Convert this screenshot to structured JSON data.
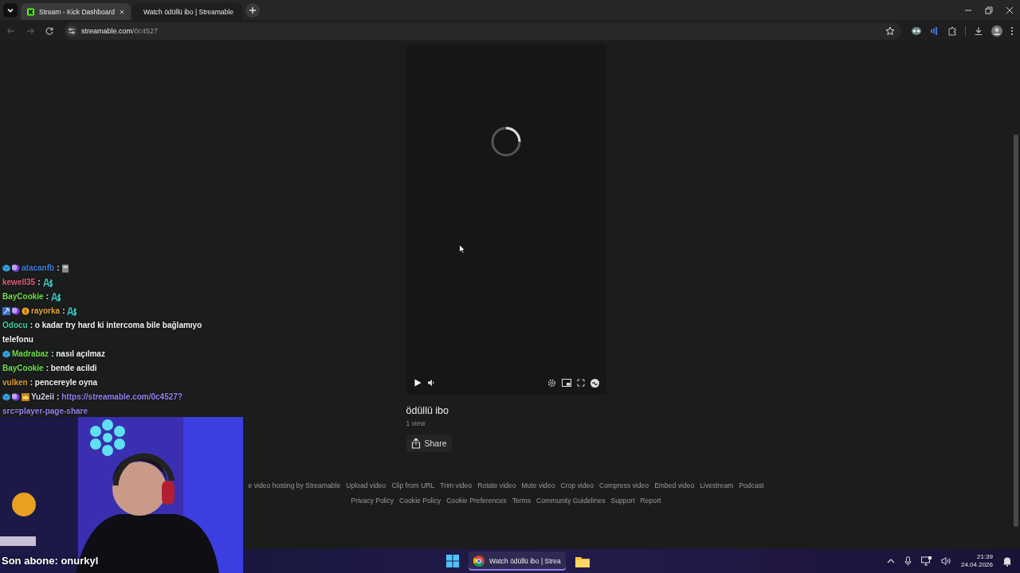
{
  "browser": {
    "tabs": [
      {
        "title": "Stream - Kick Dashboard",
        "selected": false,
        "kind": "kick"
      },
      {
        "title": "Watch ödüllü ibo | Streamable",
        "selected": true,
        "kind": "streamable"
      }
    ],
    "url": {
      "domain": "streamable.com",
      "path": "/0c4527"
    }
  },
  "video": {
    "title": "ödüllü ibo",
    "views": "1 view",
    "share_label": "Share"
  },
  "footer": {
    "links_row_1": [
      "e video hosting by Streamable",
      "Upload video",
      "Clip from URL",
      "Trim video",
      "Rotate video",
      "Mute video",
      "Crop video",
      "Compress video",
      "Embed video",
      "Livestream",
      "Podcast"
    ],
    "links_row_2": [
      "Privacy Policy",
      "Cookie Policy",
      "Cookie Preferences",
      "Terms",
      "Community Guidelines",
      "Support",
      "Report"
    ]
  },
  "chat": {
    "messages": [
      {
        "user": "atacanfb",
        "color": "#3d7fe0",
        "badges": [
          {
            "kind": "cube"
          },
          {
            "kind": "moon"
          }
        ],
        "parts": [
          {
            "kind": "text",
            "text": ":"
          },
          {
            "kind": "sticker"
          }
        ]
      },
      {
        "user": "kewell35",
        "color": "#e0607e",
        "parts": [
          {
            "kind": "text",
            "text": ":"
          },
          {
            "kind": "emote"
          }
        ]
      },
      {
        "user": "BayCookie",
        "color": "#6ee04a",
        "parts": [
          {
            "kind": "text",
            "text": ":"
          },
          {
            "kind": "emote"
          }
        ]
      },
      {
        "user": "rayorka",
        "color": "#e8a53a",
        "badges": [
          {
            "kind": "pickaxe"
          },
          {
            "kind": "moon"
          },
          {
            "kind": "coin"
          }
        ],
        "parts": [
          {
            "kind": "text",
            "text": ":"
          },
          {
            "kind": "emote"
          }
        ]
      },
      {
        "user": "Odocu",
        "color": "#3fd0a0",
        "parts": [
          {
            "kind": "text",
            "text": ": o kadar try hard ki intercoma bile bağlamıyo"
          },
          {
            "kind": "text_line",
            "text": "telefonu"
          }
        ]
      },
      {
        "user": "Madrabaz",
        "color": "#6ee04a",
        "badges": [
          {
            "kind": "cube"
          }
        ],
        "parts": [
          {
            "kind": "text",
            "text": ": nasıl açılmaz"
          }
        ]
      },
      {
        "user": "BayCookie",
        "color": "#6ee04a",
        "parts": [
          {
            "kind": "text",
            "text": ": bende acildi"
          }
        ]
      },
      {
        "user": "vulken",
        "color": "#e09a30",
        "parts": [
          {
            "kind": "text",
            "text": ": pencereyle oyna"
          }
        ]
      },
      {
        "user": "Yu2eii",
        "color": "#d8d4f0",
        "badges": [
          {
            "kind": "cube"
          },
          {
            "kind": "moon"
          },
          {
            "kind": "crown"
          }
        ],
        "parts": [
          {
            "kind": "text",
            "text": ":"
          },
          {
            "kind": "link",
            "text": "https://streamable.com/0c4527?"
          },
          {
            "kind": "link_line",
            "text": "src=player-page-share"
          }
        ]
      }
    ]
  },
  "overlay": {
    "subscriber_text": "Son abone: onurkyl"
  },
  "taskbar": {
    "apps": [
      {
        "title": "Watch ödüllü ibo | Strea",
        "selected": true
      }
    ],
    "time": "21:39",
    "date": "24.04.2026"
  }
}
